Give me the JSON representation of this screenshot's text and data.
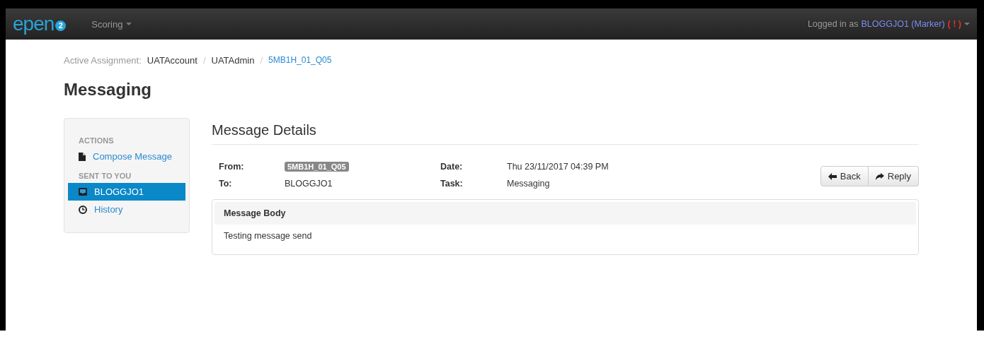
{
  "navbar": {
    "logo": {
      "text": "epen",
      "badge": "2"
    },
    "menu": "Scoring",
    "user": {
      "prefix": "Logged in as",
      "name": "BLOGGJO1 (Marker)",
      "alert": "( ! )"
    }
  },
  "breadcrumb": {
    "label": "Active Assignment:",
    "items": [
      {
        "text": "UATAccount",
        "kind": "text"
      },
      {
        "separator": "/",
        "text": "UATAdmin",
        "kind": "text"
      },
      {
        "separator": "/",
        "text": "5MB1H_01_Q05",
        "kind": "link"
      }
    ]
  },
  "page_title": "Messaging",
  "sidebar": [
    {
      "heading": "ACTIONS",
      "items": [
        {
          "label": "Compose Message",
          "kind": "document",
          "selected": false
        }
      ]
    },
    {
      "heading": "SENT TO YOU",
      "items": [
        {
          "label": "BLOGGJO1",
          "kind": "inbox",
          "selected": true
        },
        {
          "label": "History",
          "kind": "clock",
          "selected": false
        }
      ]
    }
  ],
  "details": {
    "title": "Message Details",
    "fields": [
      {
        "label": "From:",
        "value": "5MB1H_01_Q05",
        "kind": "badge"
      },
      {
        "label": "Date:",
        "value": "Thu 23/11/2017 04:39 PM",
        "kind": "text"
      },
      {
        "label": "To:",
        "value": "BLOGGJO1",
        "kind": "text"
      },
      {
        "label": "Task:",
        "value": "Messaging",
        "kind": "text"
      }
    ],
    "buttons": [
      {
        "label": "Back",
        "kind": "back"
      },
      {
        "label": "Reply",
        "kind": "reply"
      }
    ],
    "body": {
      "heading": "Message Body",
      "text": "Testing message send"
    }
  }
}
